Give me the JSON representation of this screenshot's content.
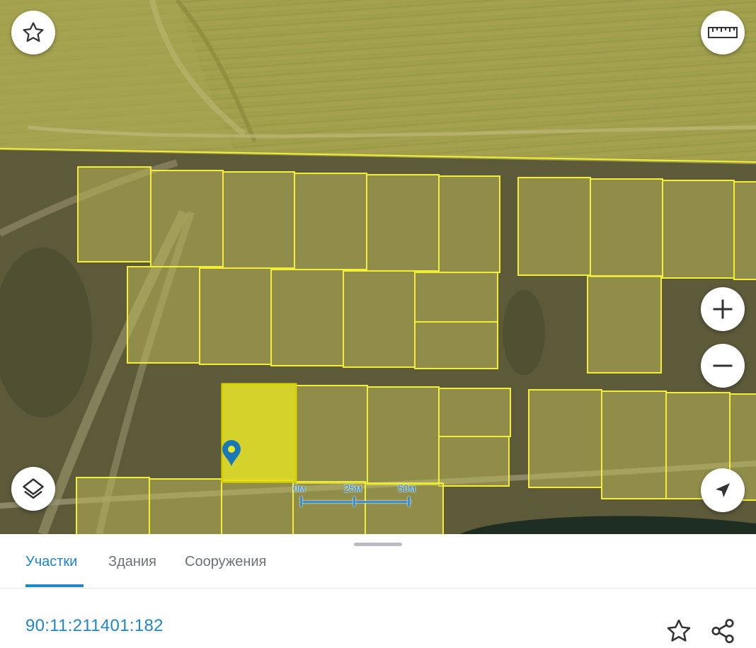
{
  "map": {
    "scale": {
      "labels": [
        "0м",
        "25м",
        "50м"
      ]
    },
    "controls": {
      "favorite_icon": "star-icon",
      "ruler_icon": "ruler-icon",
      "zoom_in_icon": "plus-icon",
      "zoom_out_icon": "minus-icon",
      "layers_icon": "layers-icon",
      "locate_icon": "navigation-arrow-icon"
    },
    "colors": {
      "parcel_outline": "#f2ee3a",
      "selected_parcel_fill": "#e9e829",
      "marker": "#1b78b8"
    }
  },
  "sheet": {
    "tabs": [
      {
        "label": "Участки",
        "active": true
      },
      {
        "label": "Здания",
        "active": false
      },
      {
        "label": "Сооружения",
        "active": false
      }
    ],
    "cadastral_number": "90:11:211401:182",
    "actions": {
      "favorite_icon": "star-icon",
      "share_icon": "share-icon"
    },
    "accent_color": "#1f86c8"
  }
}
